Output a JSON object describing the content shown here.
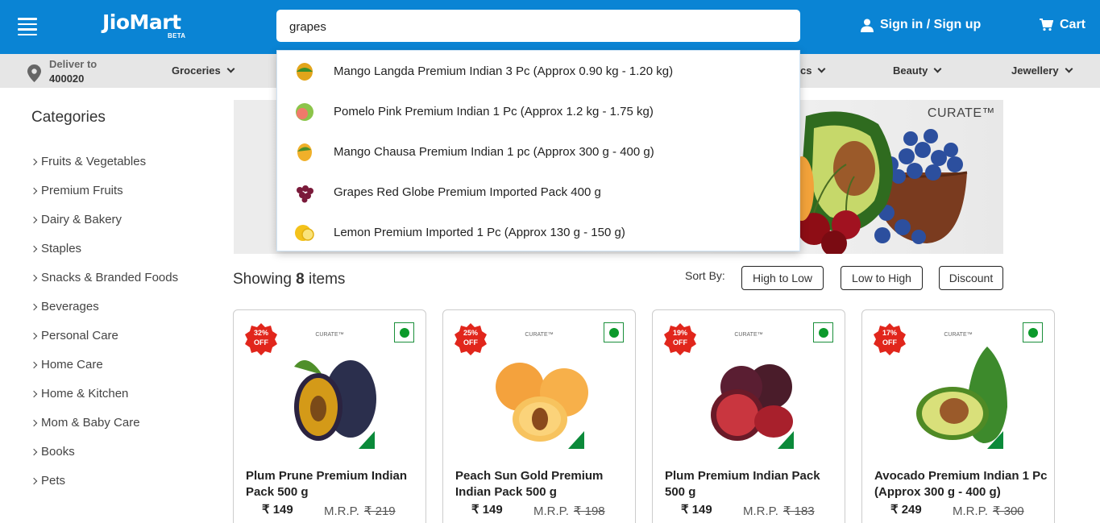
{
  "header": {
    "logo": "JioMart",
    "logo_beta": "BETA",
    "search_value": "grapes",
    "signin_label": "Sign in / Sign up",
    "cart_label": "Cart"
  },
  "subnav": {
    "deliver_label": "Deliver to",
    "deliver_pin": "400020",
    "items": [
      {
        "label": "Groceries"
      },
      {
        "label": "cs"
      },
      {
        "label": "Beauty"
      },
      {
        "label": "Jewellery"
      }
    ]
  },
  "dropdown": {
    "suggestions": [
      {
        "label": "Mango Langda Premium Indian 3 Pc (Approx 0.90 kg - 1.20 kg)",
        "icon": "mango-thumb-icon"
      },
      {
        "label": "Pomelo Pink Premium Indian 1 Pc (Approx 1.2 kg - 1.75 kg)",
        "icon": "pomelo-thumb-icon"
      },
      {
        "label": "Mango Chausa Premium Indian 1 pc (Approx 300 g - 400 g)",
        "icon": "mango-thumb-icon"
      },
      {
        "label": "Grapes Red Globe Premium Imported Pack 400 g",
        "icon": "grapes-thumb-icon"
      },
      {
        "label": "Lemon Premium Imported 1 Pc (Approx 130 g - 150 g)",
        "icon": "lemon-thumb-icon"
      }
    ]
  },
  "sidebar": {
    "title": "Categories",
    "items": [
      {
        "label": "Fruits & Vegetables"
      },
      {
        "label": "Premium Fruits"
      },
      {
        "label": "Dairy & Bakery"
      },
      {
        "label": "Staples"
      },
      {
        "label": "Snacks & Branded Foods"
      },
      {
        "label": "Beverages"
      },
      {
        "label": "Personal Care"
      },
      {
        "label": "Home Care"
      },
      {
        "label": "Home & Kitchen"
      },
      {
        "label": "Mom & Baby Care"
      },
      {
        "label": "Books"
      },
      {
        "label": "Pets"
      }
    ]
  },
  "banner": {
    "brand": "CURATE™"
  },
  "listing": {
    "showing_prefix": "Showing",
    "count": "8",
    "showing_suffix": "items",
    "sort_label": "Sort By:",
    "sort_options": [
      "High to Low",
      "Low to High",
      "Discount"
    ]
  },
  "products": [
    {
      "discount": "32%",
      "off": "OFF",
      "brand": "CURATE™",
      "name": "Plum Prune Premium Indian Pack 500 g",
      "price": "₹ 149",
      "mrp_label": "M.R.P.",
      "mrp": "₹ 219",
      "icon": "plum-prune-image"
    },
    {
      "discount": "25%",
      "off": "OFF",
      "brand": "CURATE™",
      "name": "Peach Sun Gold Premium Indian Pack 500 g",
      "price": "₹ 149",
      "mrp_label": "M.R.P.",
      "mrp": "₹ 198",
      "icon": "peach-image"
    },
    {
      "discount": "19%",
      "off": "OFF",
      "brand": "CURATE™",
      "name": "Plum Premium Indian Pack 500 g",
      "price": "₹ 149",
      "mrp_label": "M.R.P.",
      "mrp": "₹ 183",
      "icon": "plum-image"
    },
    {
      "discount": "17%",
      "off": "OFF",
      "brand": "CURATE™",
      "name": "Avocado Premium Indian 1 Pc (Approx 300 g - 400 g)",
      "price": "₹ 249",
      "mrp_label": "M.R.P.",
      "mrp": "₹ 300",
      "icon": "avocado-image"
    }
  ],
  "colors": {
    "header_bg": "#0a84d4",
    "badge_red": "#e1261c",
    "veg_green": "#0b9a2b"
  }
}
